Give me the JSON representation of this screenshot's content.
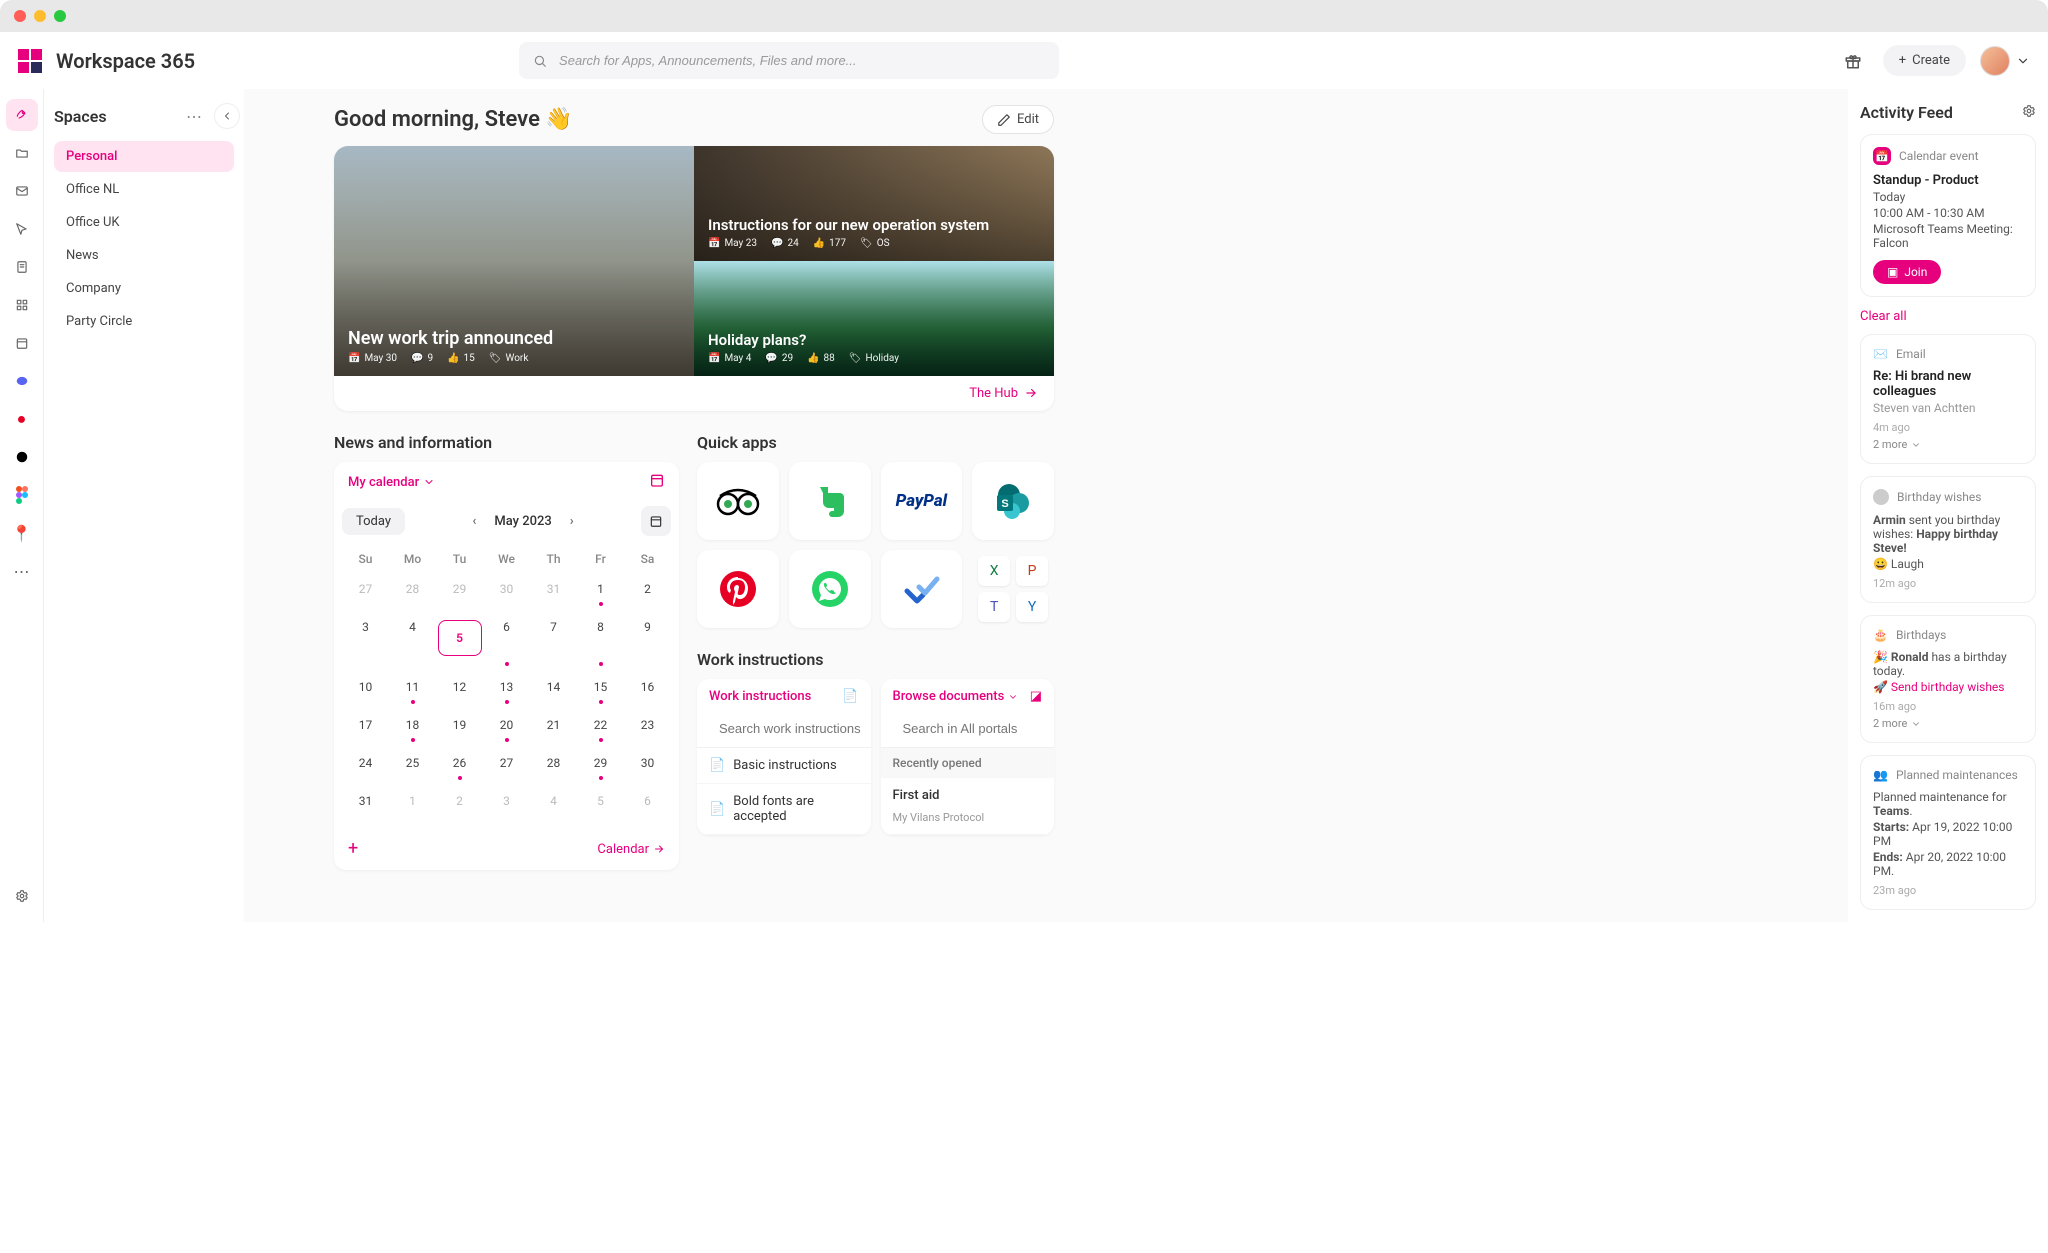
{
  "brand": "Workspace 365",
  "search": {
    "placeholder": "Search for Apps, Announcements, Files and more..."
  },
  "topbar": {
    "create": "Create"
  },
  "spaces": {
    "title": "Spaces",
    "items": [
      "Personal",
      "Office NL",
      "Office UK",
      "News",
      "Company",
      "Party Circle"
    ],
    "active": 0
  },
  "greeting": "Good morning, Steve",
  "greeting_emoji": "👋",
  "edit_label": "Edit",
  "hero": {
    "big": {
      "title": "New work trip announced",
      "date": "May 30",
      "comments": "9",
      "likes": "15",
      "tag": "Work"
    },
    "top": {
      "title": "Instructions for our new operation system",
      "date": "May 23",
      "comments": "24",
      "likes": "177",
      "tag": "OS"
    },
    "bottom": {
      "title": "Holiday plans?",
      "date": "May 4",
      "comments": "29",
      "likes": "88",
      "tag": "Holiday"
    },
    "hub_link": "The Hub"
  },
  "sections": {
    "news": "News and information",
    "apps": "Quick apps",
    "work": "Work instructions"
  },
  "calendar": {
    "dropdown": "My calendar",
    "today": "Today",
    "month": "May 2023",
    "dows": [
      "Su",
      "Mo",
      "Tu",
      "We",
      "Th",
      "Fr",
      "Sa"
    ],
    "cells": [
      {
        "n": "27",
        "muted": true
      },
      {
        "n": "28",
        "muted": true
      },
      {
        "n": "29",
        "muted": true
      },
      {
        "n": "30",
        "muted": true
      },
      {
        "n": "31",
        "muted": true
      },
      {
        "n": "1",
        "dot": true
      },
      {
        "n": "2"
      },
      {
        "n": "3"
      },
      {
        "n": "4"
      },
      {
        "n": "5",
        "today": true
      },
      {
        "n": "6",
        "dot": true
      },
      {
        "n": "7"
      },
      {
        "n": "8",
        "dot": true
      },
      {
        "n": "9"
      },
      {
        "n": "10"
      },
      {
        "n": "11",
        "dot": true
      },
      {
        "n": "12"
      },
      {
        "n": "13",
        "dot": true
      },
      {
        "n": "14"
      },
      {
        "n": "15",
        "dot": true
      },
      {
        "n": "16"
      },
      {
        "n": "17"
      },
      {
        "n": "18",
        "dot": true
      },
      {
        "n": "19"
      },
      {
        "n": "20",
        "dot": true
      },
      {
        "n": "21"
      },
      {
        "n": "22",
        "dot": true
      },
      {
        "n": "23"
      },
      {
        "n": "24"
      },
      {
        "n": "25"
      },
      {
        "n": "26",
        "dot": true
      },
      {
        "n": "27"
      },
      {
        "n": "28"
      },
      {
        "n": "29",
        "dot": true
      },
      {
        "n": "30"
      },
      {
        "n": "31"
      },
      {
        "n": "1",
        "muted": true
      },
      {
        "n": "2",
        "muted": true
      },
      {
        "n": "3",
        "muted": true
      },
      {
        "n": "4",
        "muted": true
      },
      {
        "n": "5",
        "muted": true
      },
      {
        "n": "6",
        "muted": true
      }
    ],
    "footer_link": "Calendar"
  },
  "quickapps": [
    {
      "name": "tripadvisor",
      "emoji": "",
      "color": "#34a853"
    },
    {
      "name": "evernote",
      "emoji": "",
      "color": "#2dbe60"
    },
    {
      "name": "paypal",
      "label": "PayPal",
      "color": "#003087"
    },
    {
      "name": "sharepoint",
      "emoji": "",
      "color": "#036c70"
    },
    {
      "name": "pinterest",
      "emoji": "",
      "color": "#e60023"
    },
    {
      "name": "whatsapp",
      "emoji": "",
      "color": "#25d366"
    },
    {
      "name": "todo",
      "emoji": "",
      "color": "#2564cf"
    },
    {
      "name": "office-multi",
      "multi": true
    }
  ],
  "work_instructions": {
    "left": {
      "title": "Work instructions",
      "search_placeholder": "Search work instructions",
      "items": [
        "Basic instructions",
        "Bold fonts are accepted"
      ]
    },
    "right": {
      "title": "Browse documents",
      "search_placeholder": "Search in All portals",
      "section": "Recently opened",
      "item_title": "First aid",
      "item_sub": "My Vilans Protocol"
    }
  },
  "feed": {
    "title": "Activity Feed",
    "clear": "Clear all",
    "event": {
      "kind": "Calendar event",
      "title": "Standup - Product",
      "day": "Today",
      "time": "10:00 AM - 10:30 AM",
      "meeting": "Microsoft Teams Meeting: Falcon",
      "join": "Join"
    },
    "email": {
      "kind": "Email",
      "title": "Re: Hi brand new colleagues",
      "from": "Steven van Achtten",
      "ago": "4m ago",
      "more": "2 more"
    },
    "birthday": {
      "kind": "Birthday wishes",
      "text_prefix": "Armin",
      "text_body": " sent you birthday wishes: ",
      "text_bold": "Happy birthday Steve!",
      "reaction": "😀 Laugh",
      "ago": "12m ago"
    },
    "birthdays2": {
      "kind": "Birthdays",
      "line1_prefix": "🎉 ",
      "line1_bold": "Ronald",
      "line1_rest": " has a birthday today.",
      "line2": "🚀 Send birthday wishes",
      "ago": "16m ago",
      "more": "2 more"
    },
    "maint": {
      "kind": "Planned maintenances",
      "line1_a": "Planned maintenance for ",
      "line1_b": "Teams",
      "starts_label": "Starts:",
      "starts_val": " Apr 19, 2022 10:00 PM",
      "ends_label": "Ends:",
      "ends_val": " Apr 20, 2022 10:00 PM.",
      "ago": "23m ago"
    }
  }
}
